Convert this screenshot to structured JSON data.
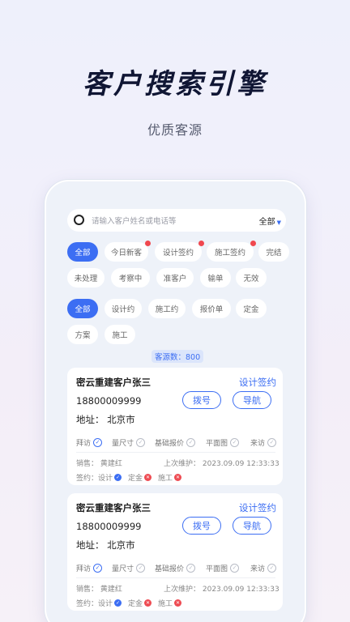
{
  "hero": {
    "title": "客户搜索引擎",
    "subtitle": "优质客源"
  },
  "search": {
    "placeholder": "请输入客户姓名或电话等",
    "filter_label": "全部"
  },
  "status_tabs": [
    {
      "label": "全部",
      "active": true,
      "dot": false
    },
    {
      "label": "今日新客",
      "active": false,
      "dot": true
    },
    {
      "label": "设计签约",
      "active": false,
      "dot": true
    },
    {
      "label": "施工签约",
      "active": false,
      "dot": true
    },
    {
      "label": "完结",
      "active": false,
      "dot": false
    },
    {
      "label": "未处理",
      "active": false,
      "dot": false
    },
    {
      "label": "考察中",
      "active": false,
      "dot": false
    },
    {
      "label": "准客户",
      "active": false,
      "dot": false
    },
    {
      "label": "输单",
      "active": false,
      "dot": false
    },
    {
      "label": "无效",
      "active": false,
      "dot": false
    }
  ],
  "type_tabs": [
    {
      "label": "全部",
      "active": true
    },
    {
      "label": "设计约",
      "active": false
    },
    {
      "label": "施工约",
      "active": false
    },
    {
      "label": "报价单",
      "active": false
    },
    {
      "label": "定金",
      "active": false
    },
    {
      "label": "方案",
      "active": false
    },
    {
      "label": "施工",
      "active": false
    }
  ],
  "source_count": "客源数：800",
  "cards": [
    {
      "name": "密云重建客户张三",
      "status": "设计签约",
      "phone": "18800009999",
      "address": "地址：  北京市",
      "dial_label": "拨号",
      "nav_label": "导航",
      "steps": [
        {
          "label": "拜访",
          "done": true
        },
        {
          "label": "量尺寸",
          "done": false
        },
        {
          "label": "基础报价",
          "done": false
        },
        {
          "label": "平面图",
          "done": false
        },
        {
          "label": "来访",
          "done": false
        }
      ],
      "sales": "销售：  黄建红",
      "last_maint": "上次维护：  2023.09.09 12:33:33",
      "sign_label": "签约：",
      "sign_items": [
        {
          "label": "设计",
          "ok": true
        },
        {
          "label": "定金",
          "ok": false
        },
        {
          "label": "施工",
          "ok": false
        }
      ]
    },
    {
      "name": "密云重建客户张三",
      "status": "设计签约",
      "phone": "18800009999",
      "address": "地址：  北京市",
      "dial_label": "拨号",
      "nav_label": "导航",
      "steps": [
        {
          "label": "拜访",
          "done": true
        },
        {
          "label": "量尺寸",
          "done": false
        },
        {
          "label": "基础报价",
          "done": false
        },
        {
          "label": "平面图",
          "done": false
        },
        {
          "label": "来访",
          "done": false
        }
      ],
      "sales": "销售：  黄建红",
      "last_maint": "上次维护：  2023.09.09 12:33:33",
      "sign_label": "签约：",
      "sign_items": [
        {
          "label": "设计",
          "ok": true
        },
        {
          "label": "定金",
          "ok": false
        },
        {
          "label": "施工",
          "ok": false
        }
      ]
    }
  ],
  "colors": {
    "accent": "#3c6ef3",
    "danger": "#ee4b52",
    "hero_title": "#101634"
  }
}
